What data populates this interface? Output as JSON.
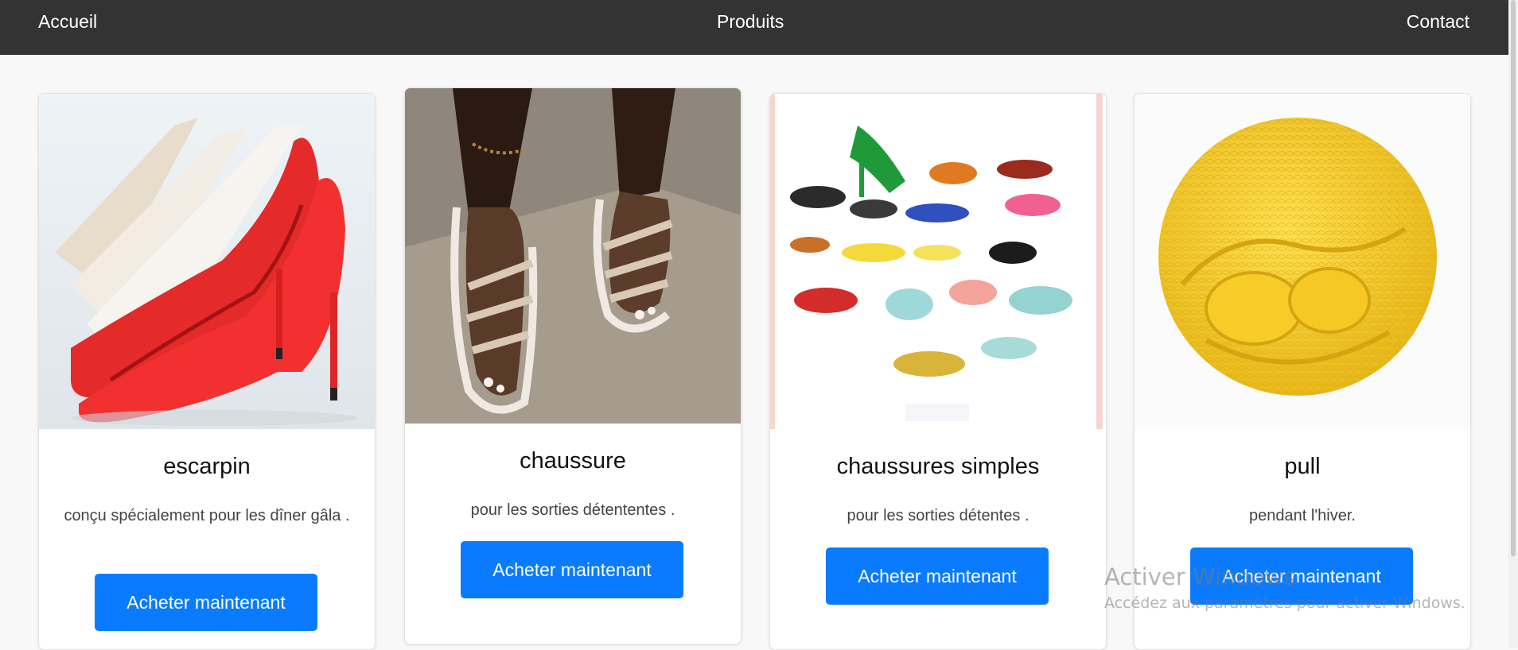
{
  "nav": {
    "home": "Accueil",
    "products": "Produits",
    "contact": "Contact",
    "background": "#333333"
  },
  "accent": "#0a7bff",
  "products": [
    {
      "image": "red-high-heel-pumps-photo",
      "title": "escarpin",
      "description": "conçu spécialement pour les dîner gâla .",
      "button": "Acheter maintenant"
    },
    {
      "image": "strappy-sandals-photo",
      "title": "chaussure",
      "description": "pour les sorties détententes .",
      "button": "Acheter maintenant"
    },
    {
      "image": "assorted-sandals-collage-photo",
      "title": "chaussures simples",
      "description": "pour les sorties détentes .",
      "button": "Acheter maintenant"
    },
    {
      "image": "yellow-knit-hat-photo",
      "title": "pull",
      "description": "pendant l'hiver.",
      "button": "Acheter maintenant"
    }
  ],
  "watermark": {
    "line1": "Activer Windows",
    "line2": "Accédez aux paramètres pour activer Windows."
  }
}
